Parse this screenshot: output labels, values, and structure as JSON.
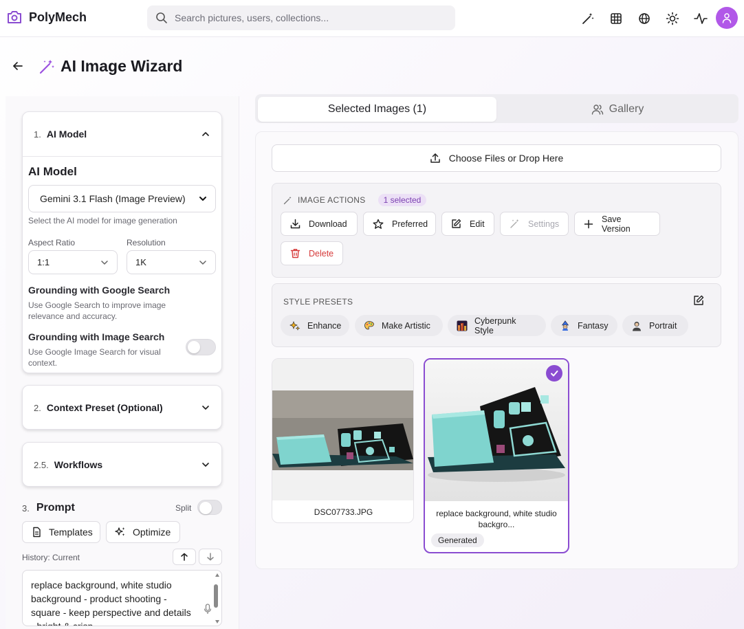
{
  "app": {
    "name": "PolyMech"
  },
  "search": {
    "placeholder": "Search pictures, users, collections..."
  },
  "header_icons": [
    "magic-wand-icon",
    "grid-icon",
    "globe-icon",
    "sun-icon",
    "activity-icon",
    "user-icon"
  ],
  "page": {
    "title": "AI Image Wizard"
  },
  "model_section": {
    "number": "1.",
    "label": "AI Model",
    "field_title": "AI Model",
    "selected_model": "Gemini 3.1 Flash (Image Preview)",
    "hint": "Select the AI model for image generation",
    "aspect_ratio_label": "Aspect Ratio",
    "aspect_ratio_value": "1:1",
    "resolution_label": "Resolution",
    "resolution_value": "1K",
    "google_grounding_label": "Grounding with Google Search",
    "google_grounding_hint": "Use Google Search to improve image relevance and accuracy.",
    "image_grounding_label": "Grounding with Image Search",
    "image_grounding_hint": "Use Google Image Search for visual context."
  },
  "context_section": {
    "number": "2.",
    "label": "Context Preset (Optional)"
  },
  "workflows_section": {
    "number": "2.5.",
    "label": "Workflows"
  },
  "prompt_section": {
    "number": "3.",
    "label": "Prompt",
    "split_label": "Split",
    "templates_label": "Templates",
    "optimize_label": "Optimize",
    "history_label": "History: Current",
    "prompt_text": "replace background, white studio background - product shooting - square - keep perspective and details - bright & crisp"
  },
  "tabs": {
    "selected": "Selected Images (1)",
    "gallery": "Gallery"
  },
  "upload": {
    "label": "Choose Files or Drop Here"
  },
  "image_actions": {
    "title": "IMAGE ACTIONS",
    "badge": "1 selected",
    "download": "Download",
    "preferred": "Preferred",
    "edit": "Edit",
    "settings": "Settings",
    "save_version": "Save Version",
    "delete": "Delete"
  },
  "style_presets": {
    "title": "STYLE PRESETS",
    "items": [
      "Enhance",
      "Make Artistic",
      "Cyberpunk Style",
      "Fantasy",
      "Portrait"
    ]
  },
  "images": [
    {
      "caption": "DSC07733.JPG"
    },
    {
      "caption": "replace background, white studio backgro...",
      "badge": "Generated"
    }
  ],
  "colors": {
    "accent": "#8a4cd1",
    "avatar": "#b158e8",
    "danger": "#d63a3a"
  }
}
